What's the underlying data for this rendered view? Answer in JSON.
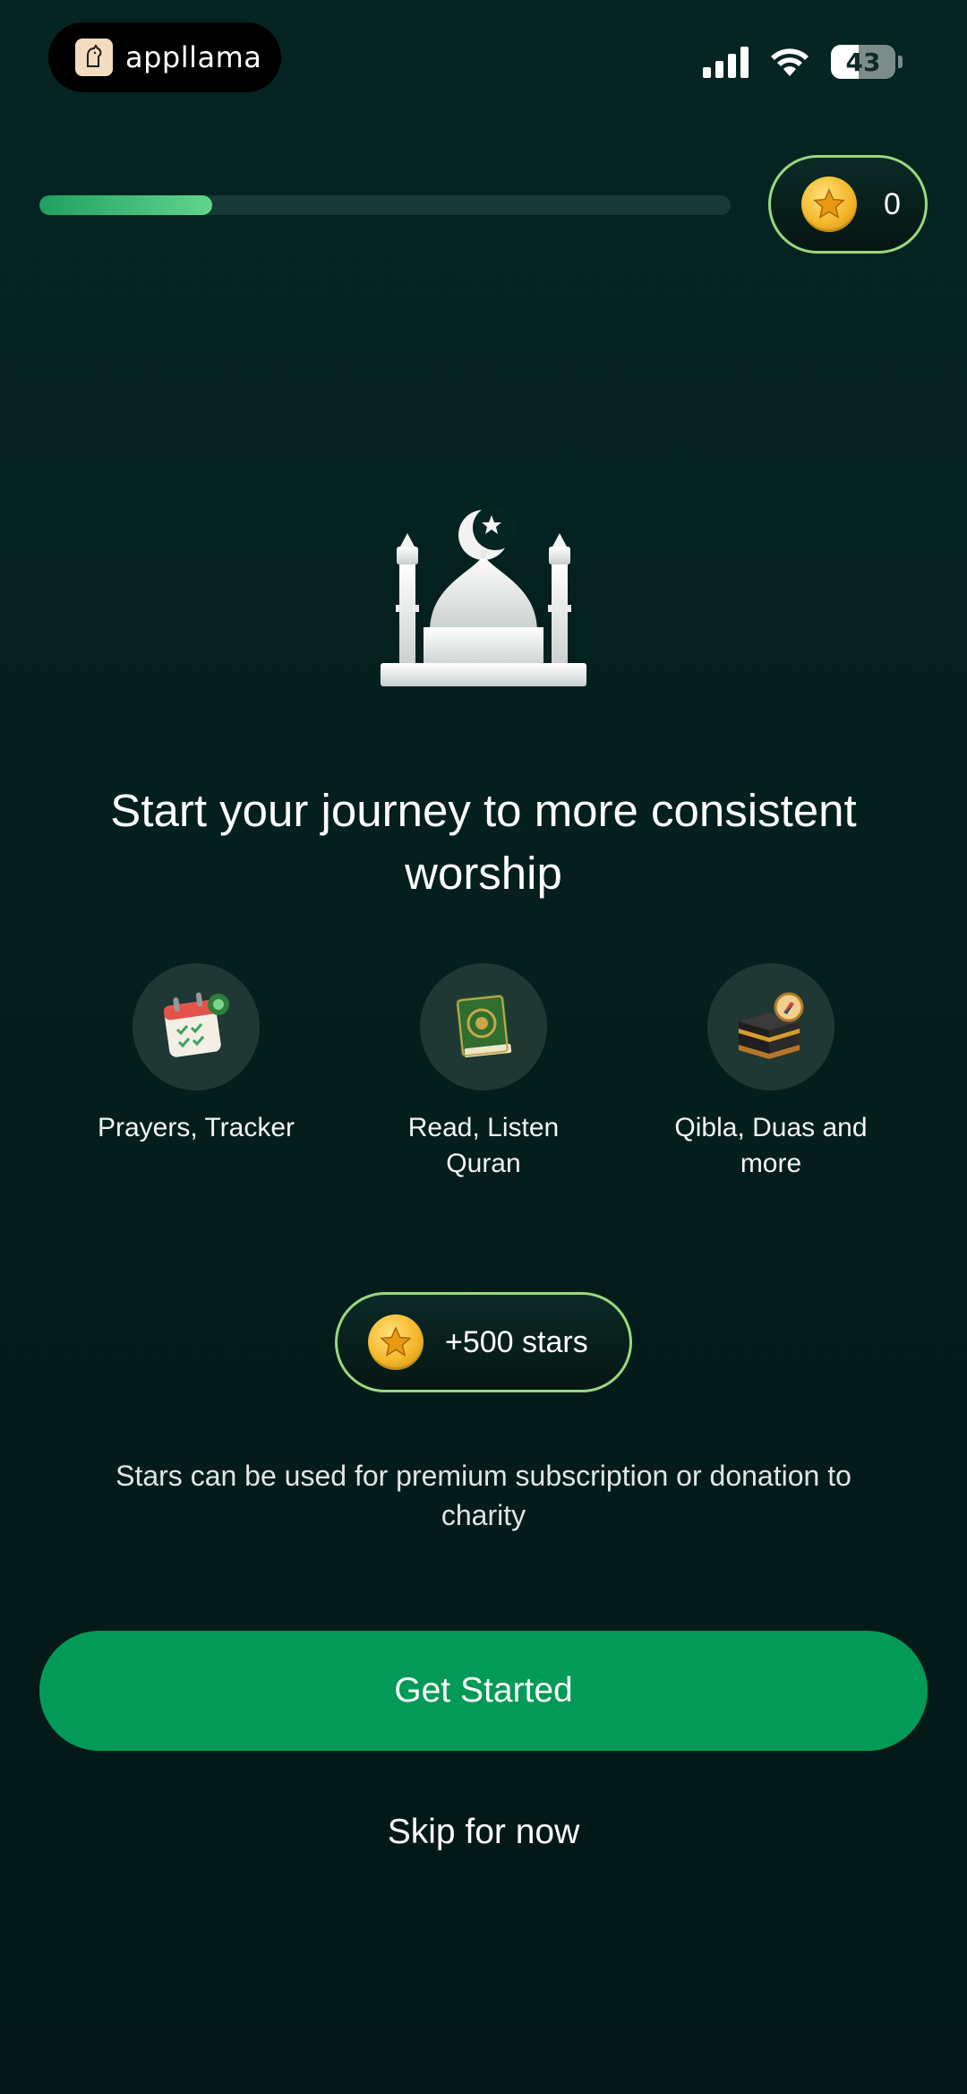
{
  "status_bar": {
    "app_name": "appllama",
    "battery": "43",
    "battery_level": 0.43,
    "icons": [
      "signal-icon",
      "wifi-icon",
      "battery-icon"
    ]
  },
  "progress": {
    "value": 0.25
  },
  "coins": {
    "count": "0",
    "icon": "star-coin-icon"
  },
  "hero": {
    "icon": "mosque-icon",
    "headline": "Start your journey to more consistent worship"
  },
  "features": [
    {
      "icon": "calendar-check-icon",
      "label": "Prayers, Tracker"
    },
    {
      "icon": "quran-book-icon",
      "label": "Read, Listen Quran"
    },
    {
      "icon": "kaaba-compass-icon",
      "label": "Qibla, Duas and more"
    }
  ],
  "reward": {
    "label": "+500 stars",
    "icon": "star-coin-icon"
  },
  "info": "Stars can be used for premium subscription or donation to charity",
  "actions": {
    "primary": "Get Started",
    "secondary": "Skip for now"
  },
  "colors": {
    "background": "#052522",
    "accent": "#029a56",
    "pill_border": "#9ad87c",
    "coin": "#f4b82a"
  }
}
